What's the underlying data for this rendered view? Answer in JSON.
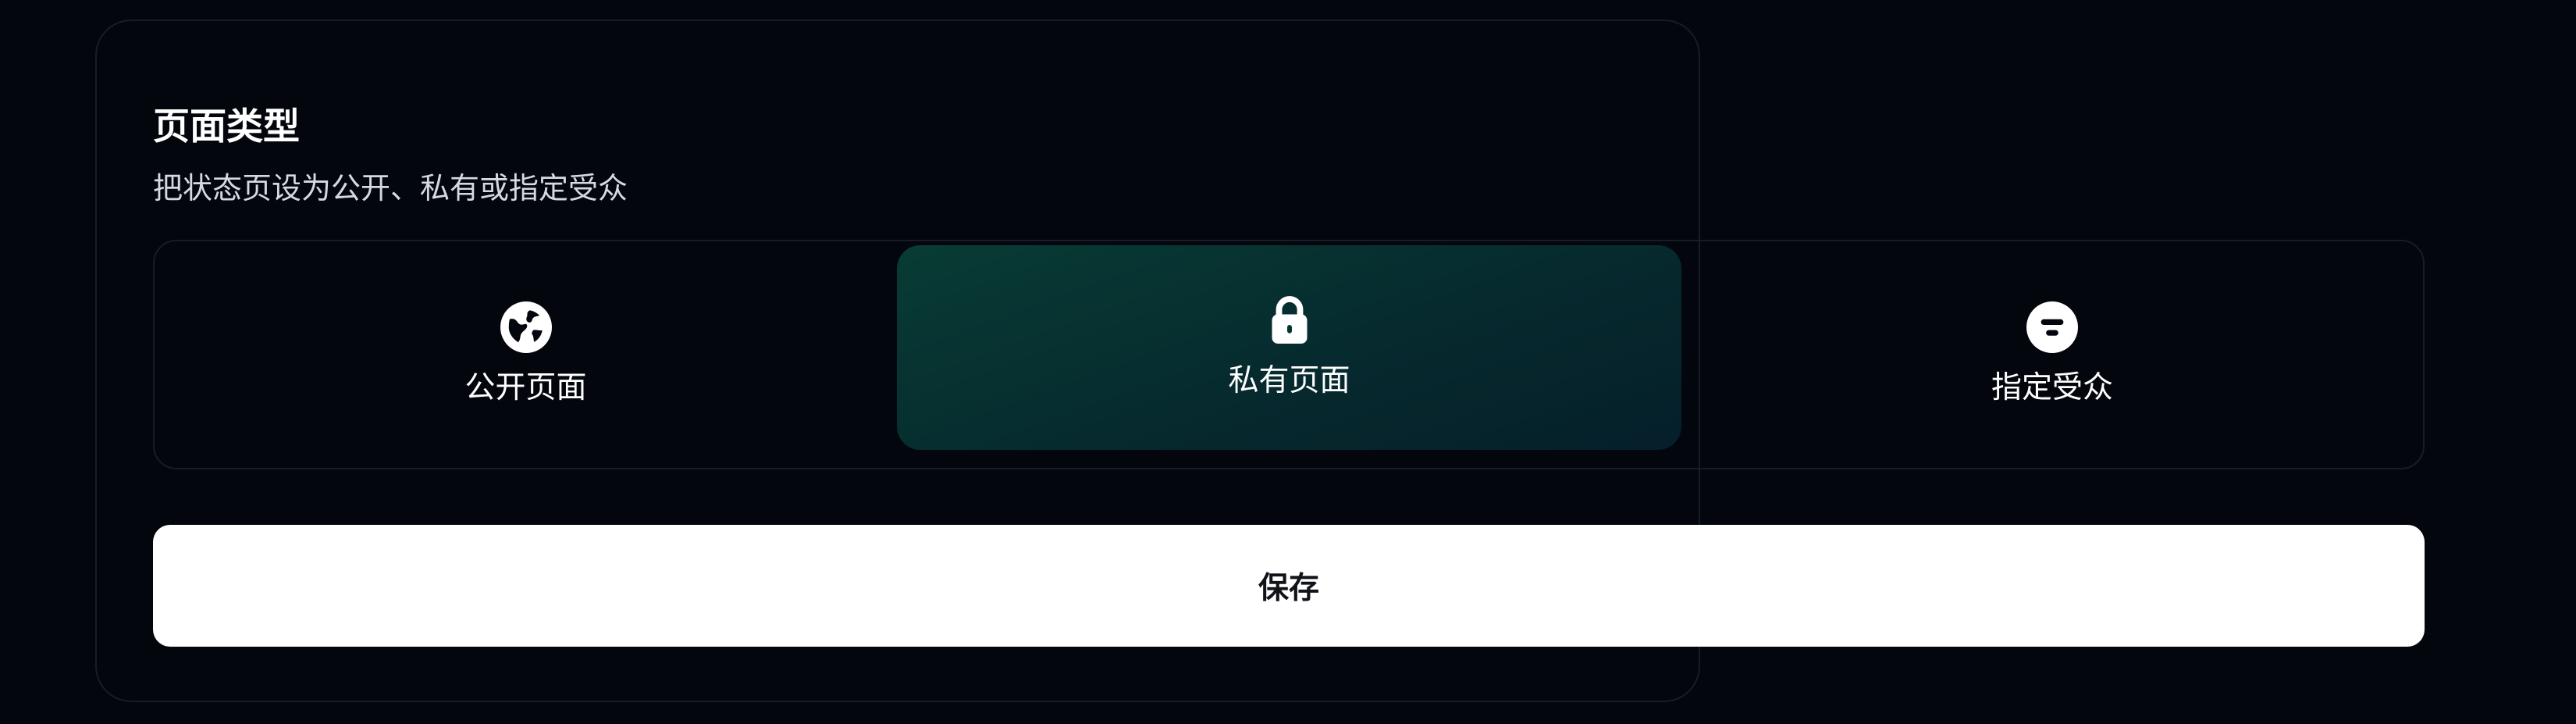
{
  "section": {
    "title": "页面类型",
    "subtitle": "把状态页设为公开、私有或指定受众"
  },
  "options": [
    {
      "label": "公开页面",
      "icon": "globe-icon",
      "selected": false
    },
    {
      "label": "私有页面",
      "icon": "lock-icon",
      "selected": true
    },
    {
      "label": "指定受众",
      "icon": "audience-icon",
      "selected": false
    }
  ],
  "actions": {
    "save_label": "保存"
  },
  "colors": {
    "background": "#03060d",
    "border": "#171c29",
    "selected_bg": "#073630",
    "button_bg": "#ffffff",
    "text": "#ffffff"
  }
}
